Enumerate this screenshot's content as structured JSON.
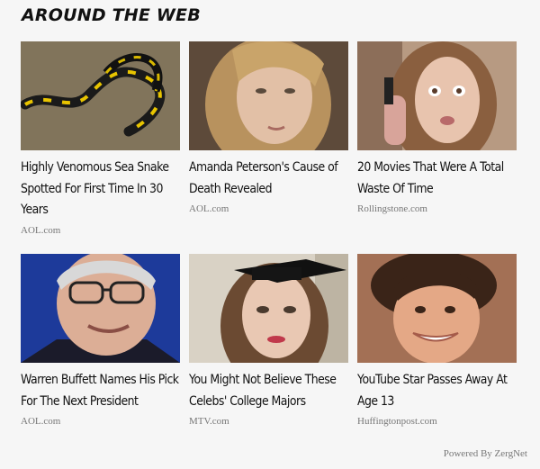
{
  "widget": {
    "heading": "AROUND THE WEB",
    "powered_by": "Powered By ZergNet",
    "cards": [
      {
        "title": "Highly Venomous Sea Snake Spotted For First Time In 30 Years",
        "source": "AOL.com",
        "thumb_icon": "sea-snake-photo"
      },
      {
        "title": "Amanda Peterson's Cause of Death Revealed",
        "source": "AOL.com",
        "thumb_icon": "portrait-photo"
      },
      {
        "title": "20 Movies That Were A Total Waste Of Time",
        "source": "Rollingstone.com",
        "thumb_icon": "portrait-photo"
      },
      {
        "title": "Warren Buffett Names His Pick For The Next President",
        "source": "AOL.com",
        "thumb_icon": "portrait-photo"
      },
      {
        "title": "You Might Not Believe These Celebs' College Majors",
        "source": "MTV.com",
        "thumb_icon": "portrait-photo"
      },
      {
        "title": "YouTube Star Passes Away At Age 13",
        "source": "Huffingtonpost.com",
        "thumb_icon": "portrait-photo"
      }
    ]
  }
}
